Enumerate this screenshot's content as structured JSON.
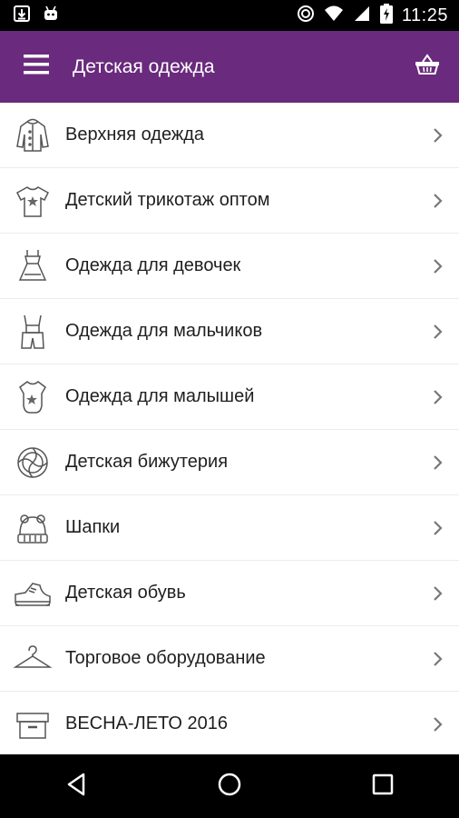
{
  "status_bar": {
    "time": "11:25",
    "left_icons": [
      "download-icon",
      "android-icon"
    ],
    "right_icons": [
      "sync-icon",
      "wifi-icon",
      "signal-icon",
      "battery-charging-icon"
    ]
  },
  "app_bar": {
    "title": "Детская одежда",
    "background": "#6a2a7d",
    "menu_icon": "hamburger-menu-icon",
    "cart_icon": "basket-icon"
  },
  "categories": [
    {
      "label": "Верхняя одежда",
      "icon": "jacket-icon"
    },
    {
      "label": "Детский трикотаж оптом",
      "icon": "tshirt-icon"
    },
    {
      "label": "Одежда для девочек",
      "icon": "dress-icon"
    },
    {
      "label": "Одежда для мальчиков",
      "icon": "overalls-icon"
    },
    {
      "label": "Одежда для малышей",
      "icon": "bodysuit-icon"
    },
    {
      "label": "Детская бижутерия",
      "icon": "bracelet-icon"
    },
    {
      "label": "Шапки",
      "icon": "hat-icon"
    },
    {
      "label": "Детская обувь",
      "icon": "sneaker-icon"
    },
    {
      "label": "Торговое оборудование",
      "icon": "hanger-icon"
    },
    {
      "label": "ВЕСНА-ЛЕТО 2016",
      "icon": "box-icon"
    }
  ],
  "nav_bar": {
    "icons": [
      "back-icon",
      "home-icon",
      "recents-icon"
    ]
  }
}
